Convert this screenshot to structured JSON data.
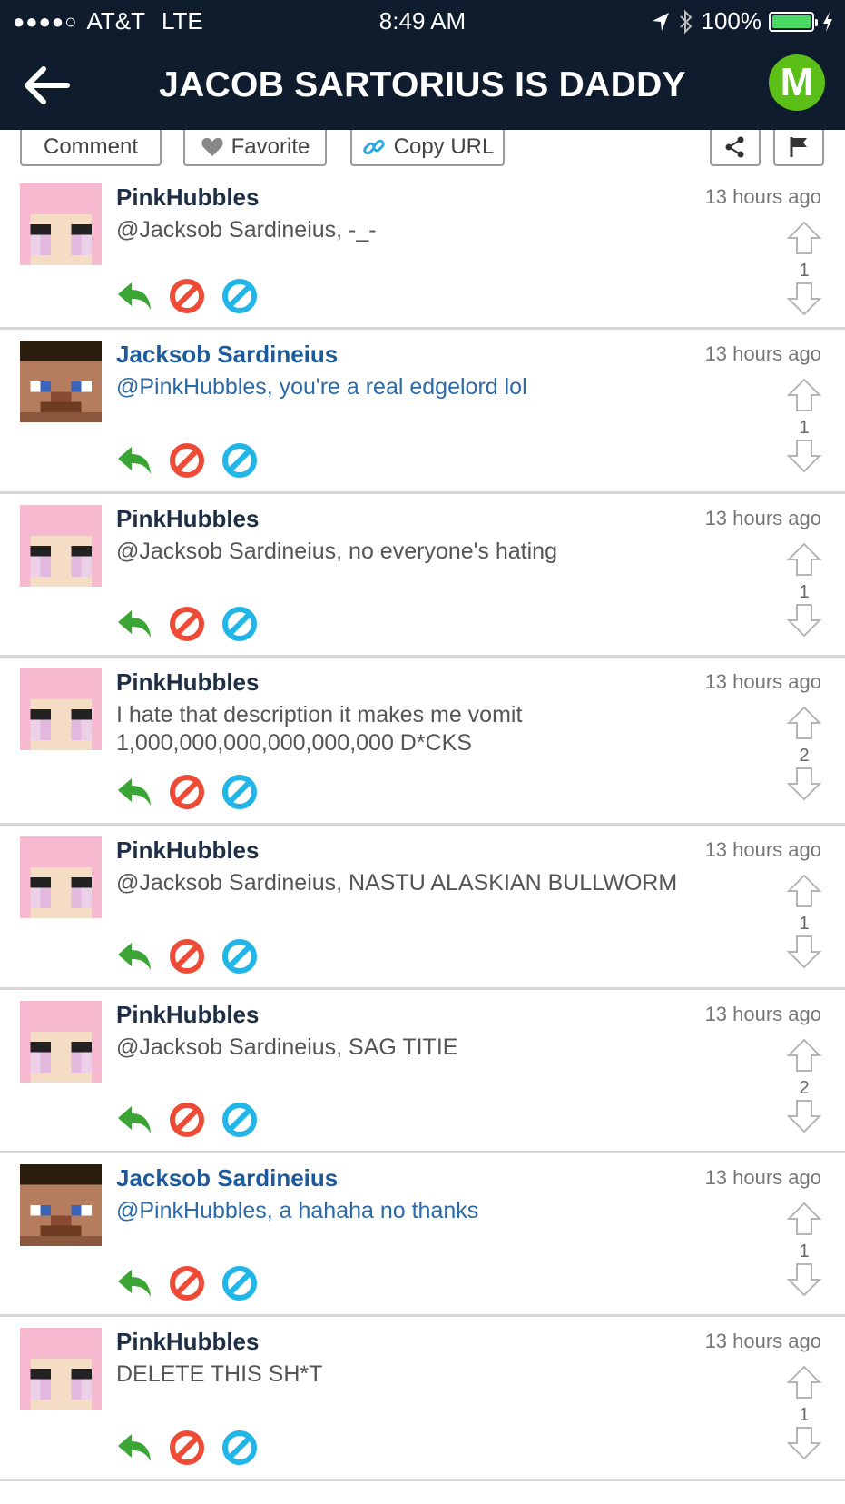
{
  "status_bar": {
    "signal": "●●●●○",
    "carrier": "AT&T",
    "network": "LTE",
    "time": "8:49 AM",
    "battery": "100%"
  },
  "header": {
    "title": "JACOB SARTORIUS IS DADDY",
    "logo_letter": "M"
  },
  "actions": {
    "comment": "Comment",
    "favorite": "Favorite",
    "copy_url": "Copy URL"
  },
  "colors": {
    "header_bg": "#0e1c2e",
    "reply_green": "#3aa535",
    "block_red": "#ee4b37",
    "hide_blue": "#22b5e8"
  },
  "comments": [
    {
      "user": "PinkHubbles",
      "avatar": "pink",
      "time": "13 hours ago",
      "text": "@Jacksob Sardineius, -_-",
      "votes": "1"
    },
    {
      "user": "Jacksob Sardineius",
      "avatar": "steve",
      "time": "13 hours ago",
      "text": "@PinkHubbles, you're a real edgelord lol",
      "votes": "1"
    },
    {
      "user": "PinkHubbles",
      "avatar": "pink",
      "time": "13 hours ago",
      "text": "@Jacksob Sardineius, no everyone's hating",
      "votes": "1"
    },
    {
      "user": "PinkHubbles",
      "avatar": "pink",
      "time": "13 hours ago",
      "text": "I hate that description it makes me vomit 1,000,000,000,000,000,000 D*CKS",
      "votes": "2"
    },
    {
      "user": "PinkHubbles",
      "avatar": "pink",
      "time": "13 hours ago",
      "text": "@Jacksob Sardineius, NASTU ALASKIAN BULLWORM",
      "votes": "1"
    },
    {
      "user": "PinkHubbles",
      "avatar": "pink",
      "time": "13 hours ago",
      "text": "@Jacksob Sardineius, SAG TITIE",
      "votes": "2"
    },
    {
      "user": "Jacksob Sardineius",
      "avatar": "steve",
      "time": "13 hours ago",
      "text": "@PinkHubbles, a hahaha no thanks",
      "votes": "1"
    },
    {
      "user": "PinkHubbles",
      "avatar": "pink",
      "time": "13 hours ago",
      "text": "DELETE THIS SH*T",
      "votes": "1"
    }
  ]
}
